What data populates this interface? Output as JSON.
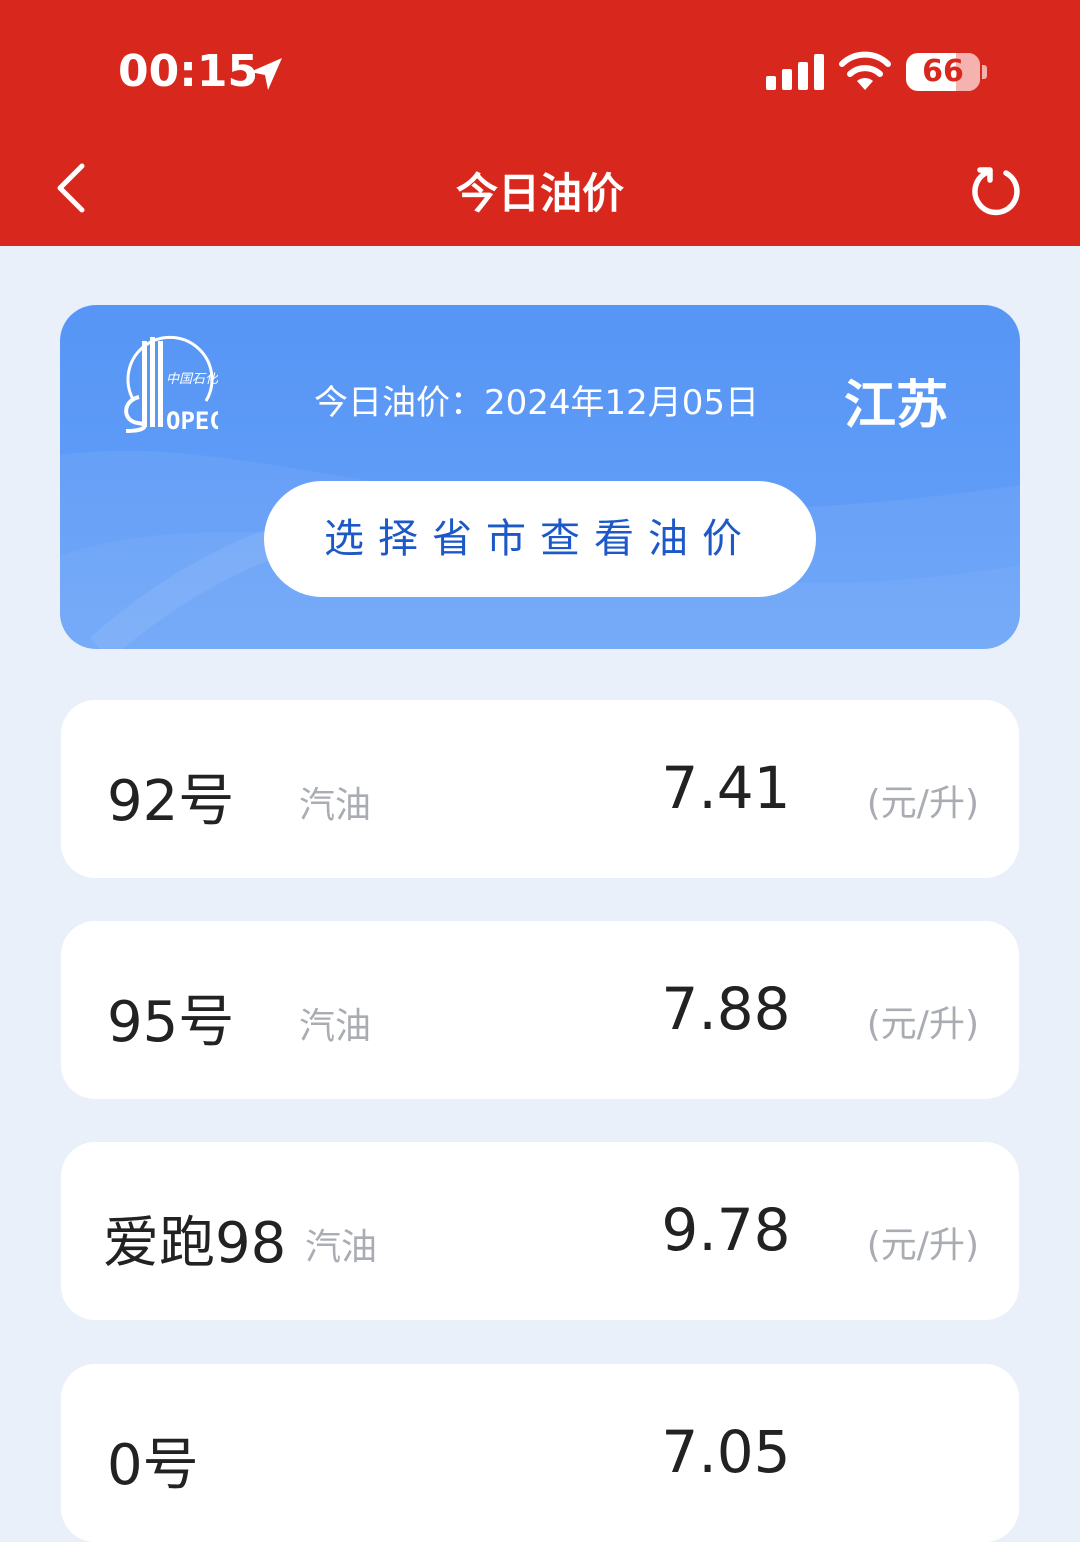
{
  "status_bar": {
    "time": "00:15",
    "battery": "66",
    "icons": [
      "location-arrow-icon",
      "cellular-signal-icon",
      "wifi-icon",
      "battery-icon"
    ]
  },
  "header": {
    "title": "今日油价",
    "back_icon": "chevron-left-icon",
    "refresh_icon": "refresh-icon",
    "background_color": "#d8281e"
  },
  "info_card": {
    "logo_icon": "sinopec-logo",
    "logo_text": "SINOPEC 中国石化",
    "date_label": "今日油价：2024年12月05日",
    "province": "江苏",
    "select_button_label": "选择省市查看油价",
    "background_color": "#5795f6"
  },
  "prices": [
    {
      "grade": "92号",
      "type": "汽油",
      "price": "7.41",
      "unit": "(元/升)"
    },
    {
      "grade": "95号",
      "type": "汽油",
      "price": "7.88",
      "unit": "(元/升)"
    },
    {
      "grade": "爱跑98",
      "type": "汽油",
      "price": "9.78",
      "unit": "(元/升)"
    },
    {
      "grade": "0号",
      "type": "",
      "price": "7.05",
      "unit": ""
    }
  ]
}
